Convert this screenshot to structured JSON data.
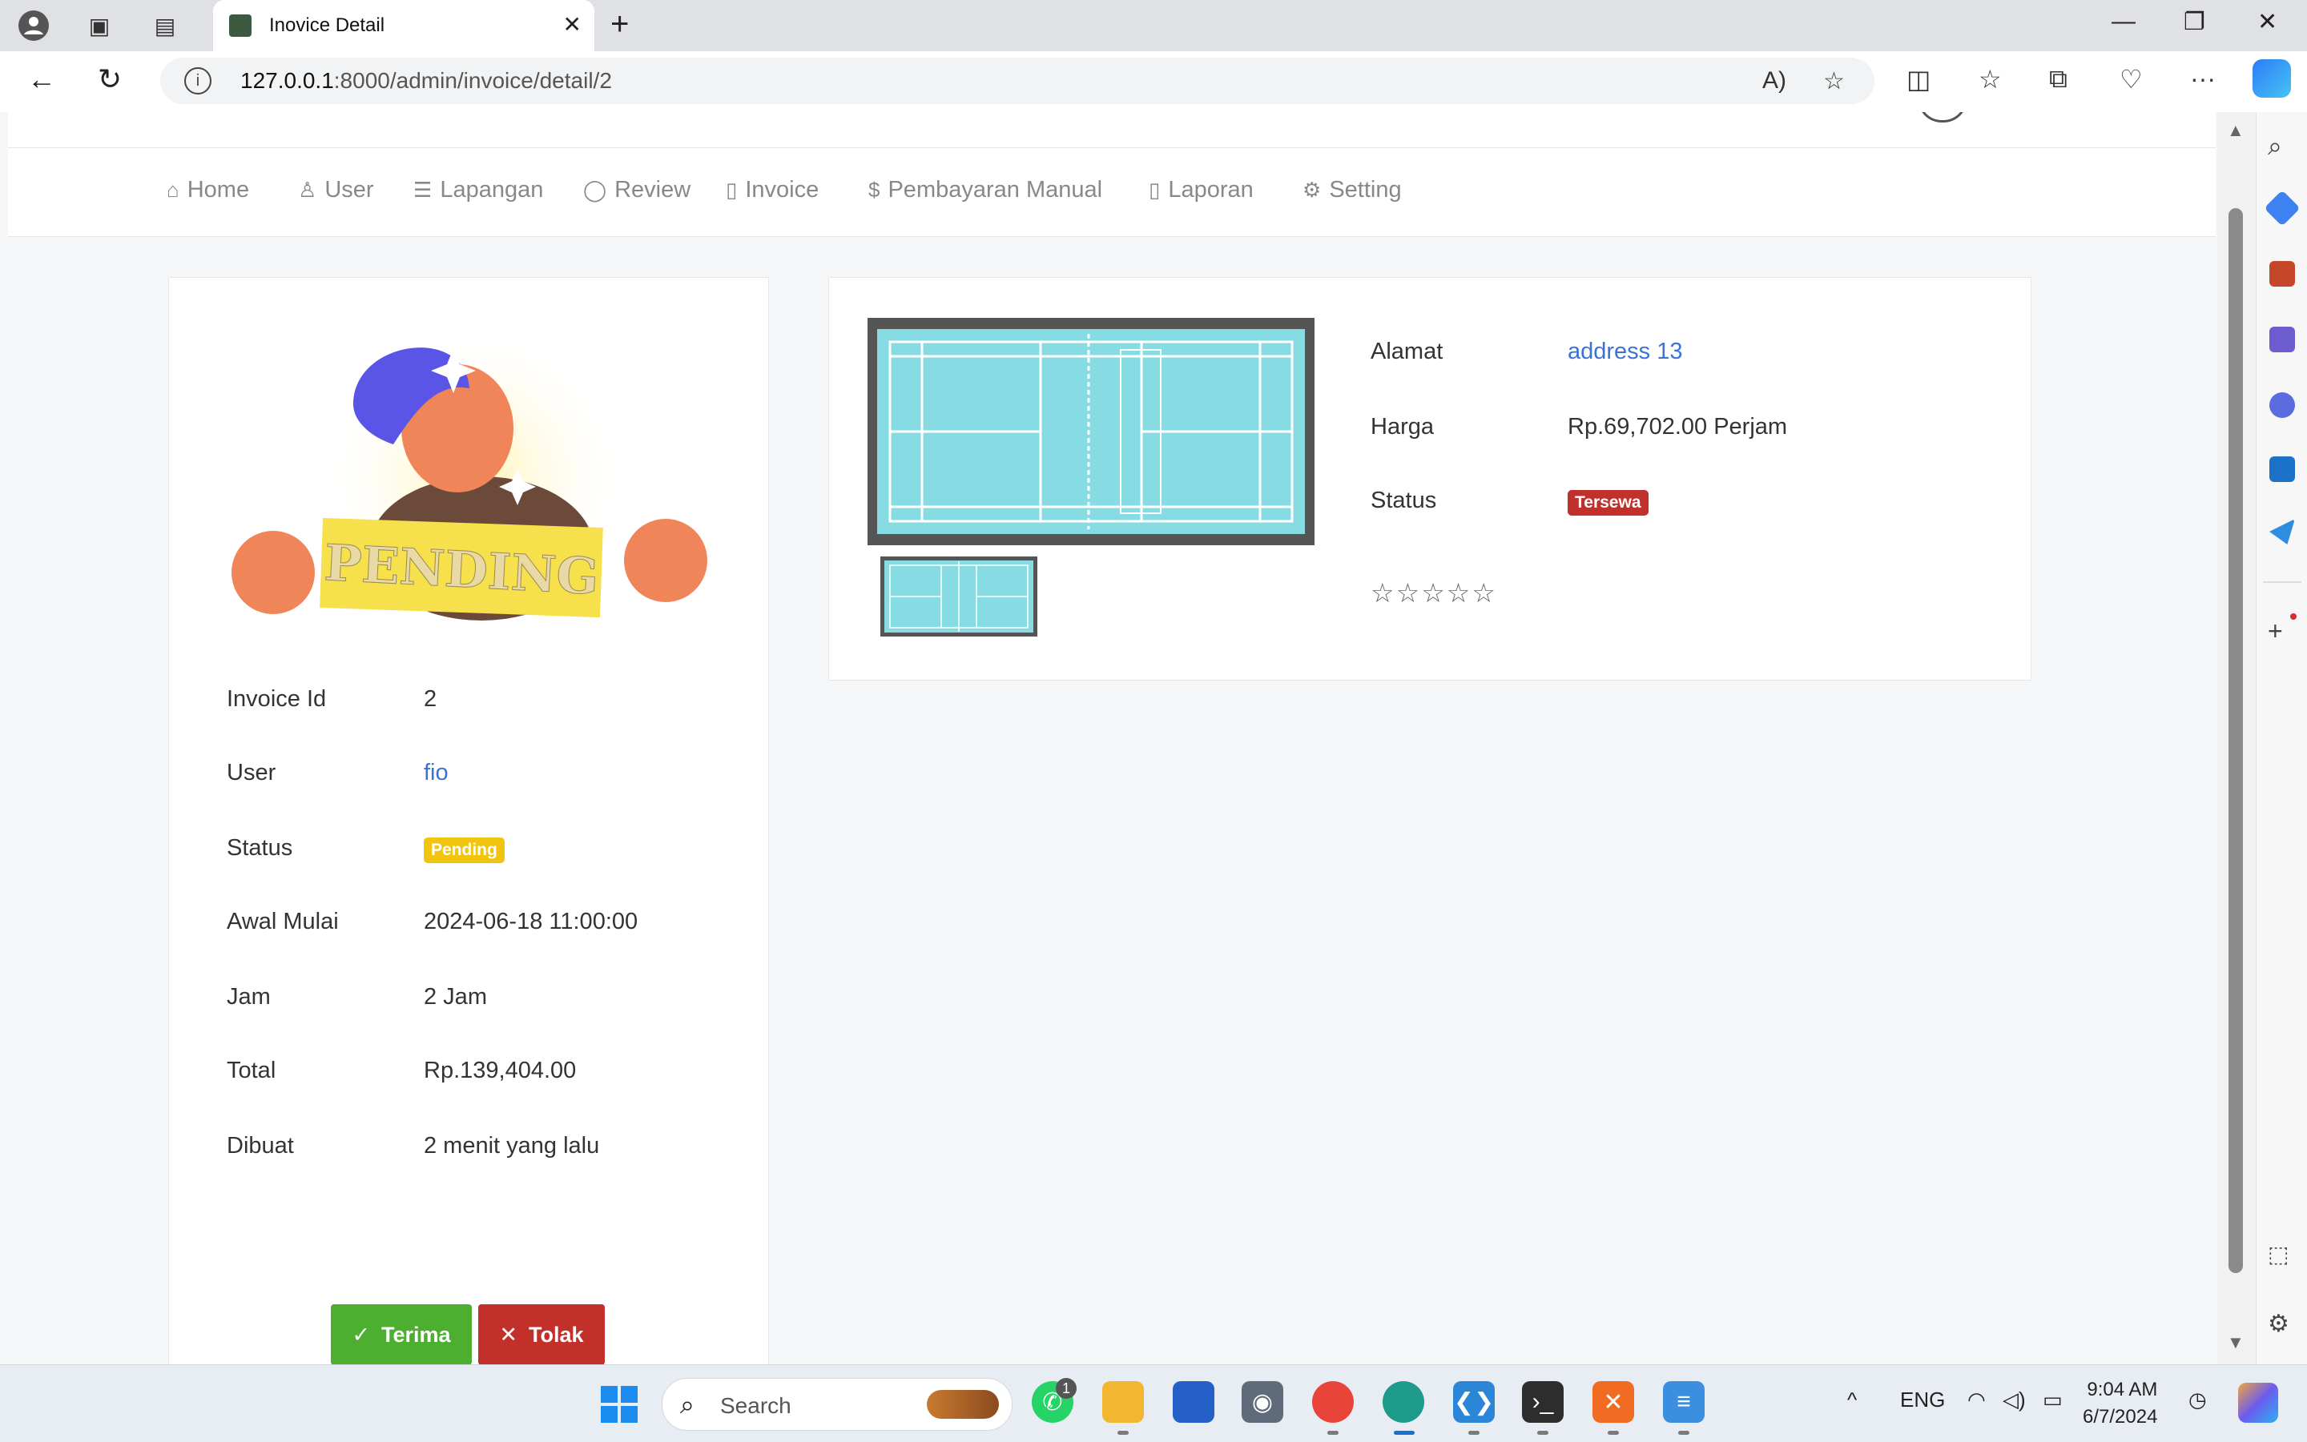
{
  "browser": {
    "tab_title": "Inovice Detail",
    "url_host": "127.0.0.1",
    "url_path": ":8000/admin/invoice/detail/2"
  },
  "nav": {
    "items": [
      {
        "label": "Home",
        "icon": "inbox-icon"
      },
      {
        "label": "User",
        "icon": "user-icon"
      },
      {
        "label": "Lapangan",
        "icon": "list-icon"
      },
      {
        "label": "Review",
        "icon": "chat-icon"
      },
      {
        "label": "Invoice",
        "icon": "clipboard-icon"
      },
      {
        "label": "Pembayaran Manual",
        "icon": "dollar-icon"
      },
      {
        "label": "Laporan",
        "icon": "file-icon"
      },
      {
        "label": "Setting",
        "icon": "gear-icon"
      }
    ]
  },
  "invoice": {
    "stamp_text": "PENDING",
    "rows": [
      {
        "label": "Invoice Id",
        "value": "2"
      },
      {
        "label": "User",
        "value": "fio"
      },
      {
        "label": "Status",
        "value": "Pending"
      },
      {
        "label": "Awal Mulai",
        "value": "2024-06-18 11:00:00"
      },
      {
        "label": "Jam",
        "value": "2 Jam"
      },
      {
        "label": "Total",
        "value": "Rp.139,404.00"
      },
      {
        "label": "Dibuat",
        "value": "2 menit yang lalu"
      }
    ],
    "accept_label": "Terima",
    "reject_label": "Tolak"
  },
  "field": {
    "rows": [
      {
        "label": "Alamat",
        "value": "address 13"
      },
      {
        "label": "Harga",
        "value": "Rp.69,702.00 Perjam"
      },
      {
        "label": "Status",
        "value": "Tersewa"
      }
    ],
    "rating": {
      "value": 0,
      "max": 5
    }
  },
  "taskbar": {
    "search_placeholder": "Search",
    "whatsapp_badge": "1",
    "language": "ENG",
    "time": "9:04 AM",
    "date": "6/7/2024"
  },
  "colors": {
    "accent_link": "#3b72d6",
    "success": "#4caf30",
    "danger": "#c3302a",
    "pending": "#f1c40f",
    "court": "#87dbe3"
  }
}
